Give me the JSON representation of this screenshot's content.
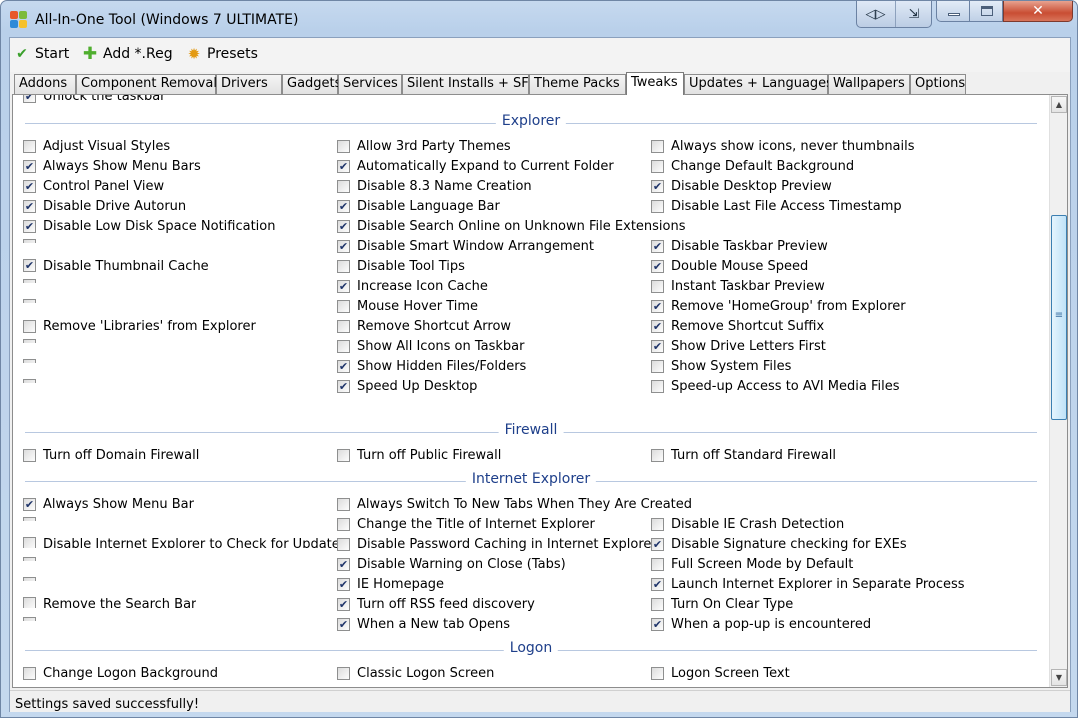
{
  "window": {
    "title": "All-In-One Tool (Windows 7 ULTIMATE)"
  },
  "toolbar": {
    "start": "Start",
    "add_reg": "Add *.Reg",
    "presets": "Presets"
  },
  "tabs": [
    "Addons",
    "Component Removal",
    "Drivers",
    "Gadgets",
    "Services",
    "Silent Installs + SFX",
    "Theme Packs",
    "Tweaks",
    "Updates + Languages",
    "Wallpapers",
    "Options"
  ],
  "active_tab": "Tweaks",
  "top_partial": {
    "label": "Unlock the taskbar",
    "checked": true
  },
  "sections": [
    {
      "title": "Explorer",
      "columns": [
        [
          {
            "label": "Adjust Visual Styles",
            "checked": false
          },
          {
            "label": "Always Show Menu Bars",
            "checked": true
          },
          {
            "label": "Control Panel View",
            "checked": true
          },
          {
            "label": "Disable Drive Autorun",
            "checked": true
          },
          {
            "label": "Disable Low Disk Space Notification",
            "checked": true
          },
          {
            "label": "",
            "checked": false
          },
          {
            "label": "Disable Thumbnail Cache",
            "checked": true
          },
          {
            "label": "",
            "checked": false
          },
          {
            "label": "",
            "checked": false
          },
          {
            "label": "Remove 'Libraries' from Explorer",
            "checked": false
          },
          {
            "label": "",
            "checked": false
          },
          {
            "label": "",
            "checked": false
          },
          {
            "label": "",
            "checked": false
          }
        ],
        [
          {
            "label": "Allow 3rd Party Themes",
            "checked": false
          },
          {
            "label": "Automatically Expand to Current Folder",
            "checked": true
          },
          {
            "label": "Disable 8.3 Name Creation",
            "checked": false
          },
          {
            "label": "Disable Language Bar",
            "checked": true
          },
          {
            "label": "Disable Search Online on Unknown File Extensions",
            "checked": true
          },
          {
            "label": "Disable Smart Window Arrangement",
            "checked": true
          },
          {
            "label": "Disable Tool Tips",
            "checked": false
          },
          {
            "label": "Increase Icon Cache",
            "checked": true
          },
          {
            "label": "Mouse Hover Time",
            "checked": false
          },
          {
            "label": "Remove Shortcut Arrow",
            "checked": false
          },
          {
            "label": "Show All Icons on Taskbar",
            "checked": false
          },
          {
            "label": "Show Hidden Files/Folders",
            "checked": true
          },
          {
            "label": "Speed Up Desktop",
            "checked": true
          }
        ],
        [
          {
            "label": "Always show icons, never thumbnails",
            "checked": false
          },
          {
            "label": "Change Default Background",
            "checked": false
          },
          {
            "label": "Disable Desktop Preview",
            "checked": true
          },
          {
            "label": "Disable Last File Access Timestamp",
            "checked": false
          },
          {
            "label": "",
            "checked": false
          },
          {
            "label": "Disable Taskbar Preview",
            "checked": true
          },
          {
            "label": "Double Mouse Speed",
            "checked": true
          },
          {
            "label": "Instant Taskbar Preview",
            "checked": false
          },
          {
            "label": "Remove 'HomeGroup' from Explorer",
            "checked": true
          },
          {
            "label": "Remove Shortcut Suffix",
            "checked": true
          },
          {
            "label": "Show Drive Letters First",
            "checked": true
          },
          {
            "label": "Show System Files",
            "checked": false
          },
          {
            "label": "Speed-up Access to AVI Media Files",
            "checked": false
          }
        ]
      ]
    },
    {
      "title": "Firewall",
      "columns": [
        [
          {
            "label": "Turn off Domain Firewall",
            "checked": false
          }
        ],
        [
          {
            "label": "Turn off Public Firewall",
            "checked": false
          }
        ],
        [
          {
            "label": "Turn off Standard Firewall",
            "checked": false
          }
        ]
      ]
    },
    {
      "title": "Internet Explorer",
      "columns": [
        [
          {
            "label": "Always Show Menu Bar",
            "checked": true
          },
          {
            "label": "",
            "checked": false
          },
          {
            "label": "Disable Internet Explorer to Check for Updates",
            "checked": false
          },
          {
            "label": "",
            "checked": false
          },
          {
            "label": "",
            "checked": false
          },
          {
            "label": "Remove the Search Bar",
            "checked": false
          },
          {
            "label": "",
            "checked": false
          }
        ],
        [
          {
            "label": "Always Switch To New Tabs When They Are Created",
            "checked": false
          },
          {
            "label": "Change the Title of Internet Explorer",
            "checked": false
          },
          {
            "label": "Disable Password Caching in Internet Explorer",
            "checked": false
          },
          {
            "label": "Disable Warning on Close (Tabs)",
            "checked": true
          },
          {
            "label": "IE Homepage",
            "checked": true
          },
          {
            "label": "Turn off RSS feed discovery",
            "checked": true
          },
          {
            "label": "When a New tab Opens",
            "checked": true
          }
        ],
        [
          {
            "label": "",
            "checked": false
          },
          {
            "label": "Disable IE Crash Detection",
            "checked": false
          },
          {
            "label": "Disable Signature checking for EXEs",
            "checked": true
          },
          {
            "label": "Full Screen Mode by Default",
            "checked": false
          },
          {
            "label": "Launch Internet Explorer in Separate Process",
            "checked": true
          },
          {
            "label": "Turn On Clear Type",
            "checked": false
          },
          {
            "label": "When a pop-up is encountered",
            "checked": true
          }
        ]
      ]
    },
    {
      "title": "Logon",
      "columns": [
        [
          {
            "label": "Change Logon Background",
            "checked": false
          }
        ],
        [
          {
            "label": "Classic Logon Screen",
            "checked": false
          }
        ],
        [
          {
            "label": "Logon Screen Text",
            "checked": false
          }
        ]
      ]
    }
  ],
  "status": {
    "text": "Settings saved successfully!"
  },
  "colors": {
    "section_title": "#1e3f8a",
    "check": "#20356a"
  }
}
